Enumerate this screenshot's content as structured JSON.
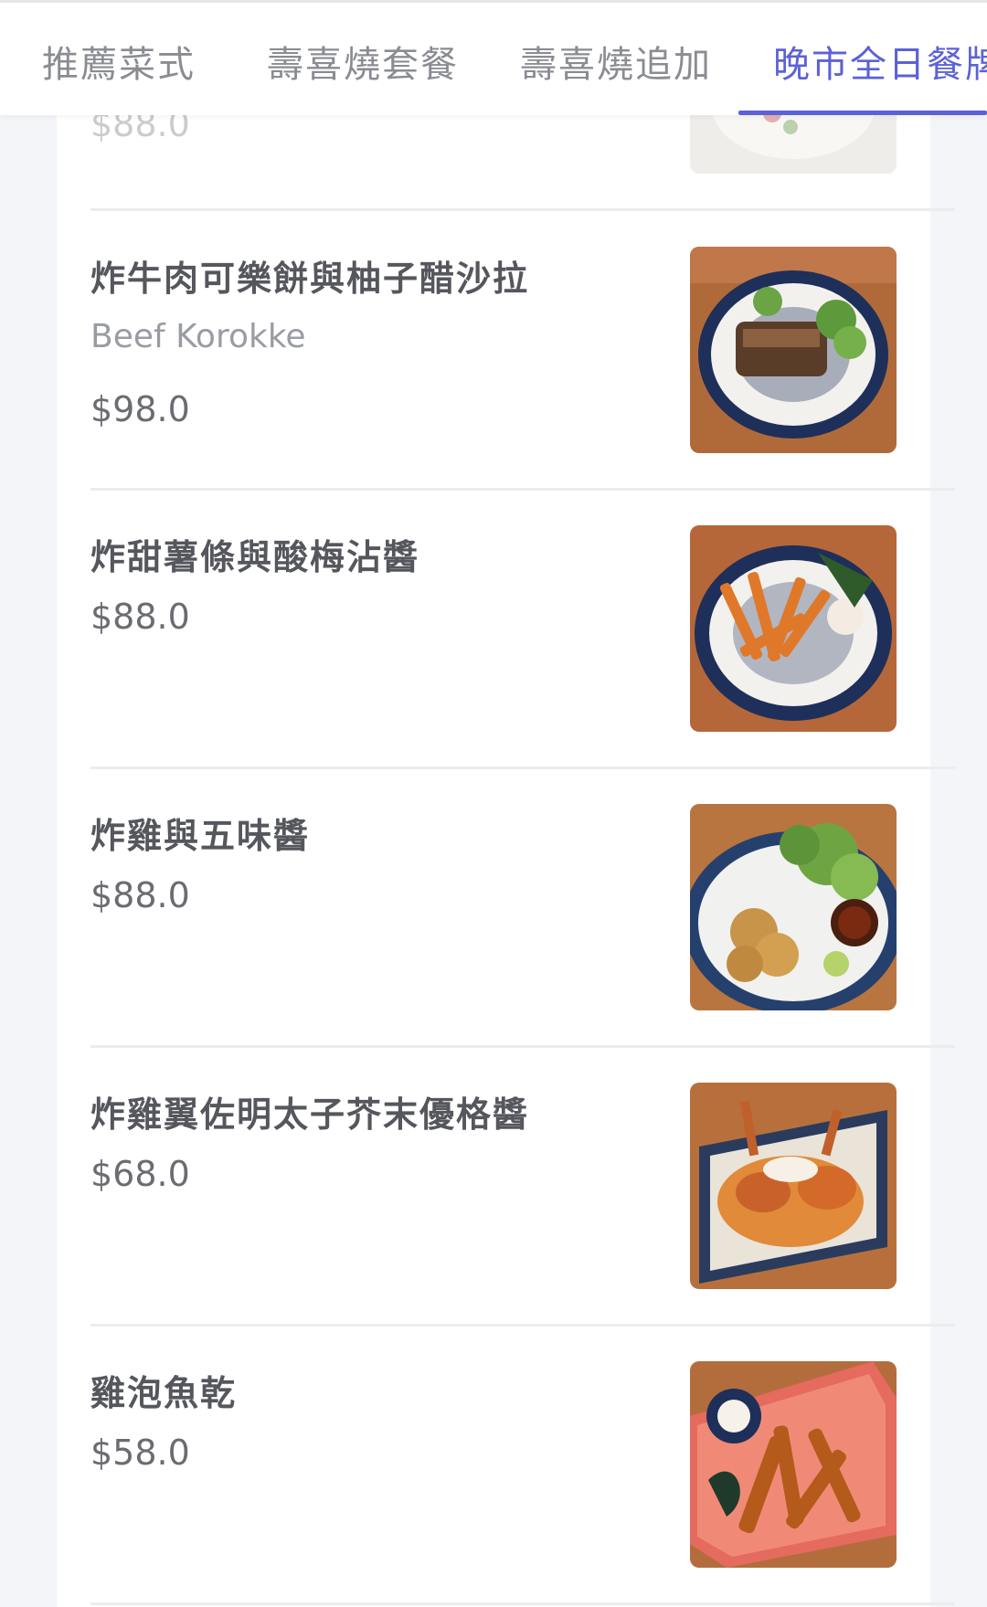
{
  "tabs": [
    {
      "label": "推薦菜式"
    },
    {
      "label": "壽喜燒套餐"
    },
    {
      "label": "壽喜燒追加"
    },
    {
      "label": "晚市全日餐牌",
      "active": true
    }
  ],
  "accent_color": "#5b62d6",
  "partial_item": {
    "price": "$88.0"
  },
  "items": [
    {
      "name": "炸牛肉可樂餅與柚子醋沙拉",
      "subtitle": "Beef Korokke",
      "price": "$98.0",
      "image": "korokke-salad-photo"
    },
    {
      "name": "炸甜薯條與酸梅沾醬",
      "subtitle": "",
      "price": "$88.0",
      "image": "sweet-potato-fries-photo"
    },
    {
      "name": "炸雞與五味醬",
      "subtitle": "",
      "price": "$88.0",
      "image": "fried-chicken-photo"
    },
    {
      "name": "炸雞翼佐明太子芥末優格醬",
      "subtitle": "",
      "price": "$68.0",
      "image": "chicken-wings-photo"
    },
    {
      "name": "雞泡魚乾",
      "subtitle": "",
      "price": "$58.0",
      "image": "dried-fish-photo"
    }
  ]
}
